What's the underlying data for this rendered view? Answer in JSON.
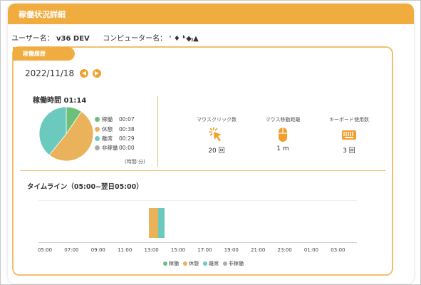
{
  "header": {
    "title": "稼働状況詳細"
  },
  "user": {
    "user_label": "ユーザー名：",
    "user_value": "v36 DEV",
    "computer_label": "コンピューター名：",
    "computer_value": "' ♦ ᵏ◆ⱼ▲"
  },
  "history": {
    "tab_label": "稼働履歴"
  },
  "date": {
    "value": "2022/11/18"
  },
  "summary": {
    "operating_time_label": "稼働時間 01:14",
    "legend": [
      {
        "label": "稼働",
        "value": "00:07",
        "color": "#6cc07a"
      },
      {
        "label": "休憩",
        "value": "00:38",
        "color": "#eab25a"
      },
      {
        "label": "離席",
        "value": "00:29",
        "color": "#6cc9bd"
      },
      {
        "label": "非稼働",
        "value": "00:00",
        "color": "#aaaaaa"
      }
    ],
    "unit_note": "(時間:分)"
  },
  "stats": {
    "mouse_click": {
      "caption": "マウスクリック数",
      "value": "20 回",
      "icon": "cursor-click-icon"
    },
    "mouse_move": {
      "caption": "マウス移動距離",
      "value": "1 m",
      "icon": "mouse-icon"
    },
    "keyboard": {
      "caption": "キーボード使用数",
      "value": "3 回",
      "icon": "keyboard-icon"
    }
  },
  "timeline": {
    "title": "タイムライン（05:00~翌日05:00）",
    "ticks": [
      "05:00",
      "07:00",
      "09:00",
      "11:00",
      "13:00",
      "15:00",
      "17:00",
      "19:00",
      "21:00",
      "23:00",
      "01:00",
      "03:00"
    ],
    "legend": [
      {
        "label": "稼働",
        "color": "#6cc07a"
      },
      {
        "label": "休憩",
        "color": "#eab25a"
      },
      {
        "label": "離席",
        "color": "#6cc9bd"
      },
      {
        "label": "非稼働",
        "color": "#aaaaaa"
      }
    ]
  },
  "chart_data": [
    {
      "type": "pie",
      "categories": [
        "稼働",
        "休憩",
        "離席",
        "非稼働"
      ],
      "values": [
        7,
        38,
        29,
        0
      ],
      "colors": [
        "#6cc07a",
        "#eab25a",
        "#6cc9bd",
        "#aaaaaa"
      ]
    },
    {
      "type": "bar",
      "x_range": [
        "05:00",
        "翌日05:00"
      ],
      "segments": [
        {
          "state": "休憩",
          "start": "12:50",
          "end": "13:30",
          "color": "#eab25a"
        },
        {
          "state": "離席",
          "start": "13:30",
          "end": "14:00",
          "color": "#6cc9bd"
        }
      ]
    }
  ]
}
